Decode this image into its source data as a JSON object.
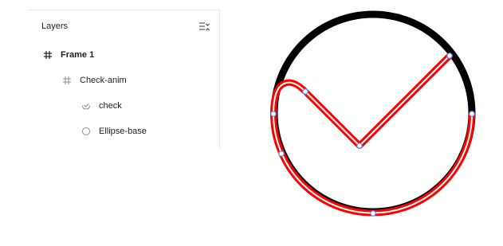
{
  "layers_panel": {
    "title": "Layers",
    "collapse_icon": "collapse-list-icon",
    "items": [
      {
        "label": "Frame 1",
        "icon": "frame-icon",
        "depth": 0,
        "selected_style": "bold"
      },
      {
        "label": "Check-anim",
        "icon": "frame-icon",
        "depth": 1
      },
      {
        "label": "check",
        "icon": "vector-check-icon",
        "depth": 2
      },
      {
        "label": "Ellipse-base",
        "icon": "ellipse-icon",
        "depth": 2
      }
    ]
  },
  "canvas": {
    "colors": {
      "ring": "#000000",
      "path_outline": "#ff0000",
      "path_inner": "#ffffff",
      "anchor_fill": "#ffffff",
      "anchor_stroke": "#4a8cff"
    }
  }
}
